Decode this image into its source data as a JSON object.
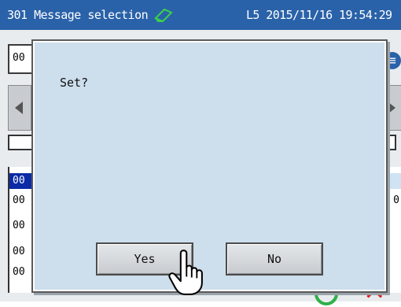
{
  "titlebar": {
    "title": "301 Message selection",
    "status": "L5 2015/11/16 19:54:29",
    "icon": "eraser-icon"
  },
  "background": {
    "field_value": "00",
    "rows": [
      "00",
      "00",
      "00",
      "00",
      "00"
    ],
    "row_suffix": "0"
  },
  "dialog": {
    "message": "Set?",
    "yes_label": "Yes",
    "no_label": "No"
  },
  "colors": {
    "titlebar": "#2a62a9",
    "dialog_bg": "#cddeec",
    "selected_row": "#0a2aa6"
  }
}
